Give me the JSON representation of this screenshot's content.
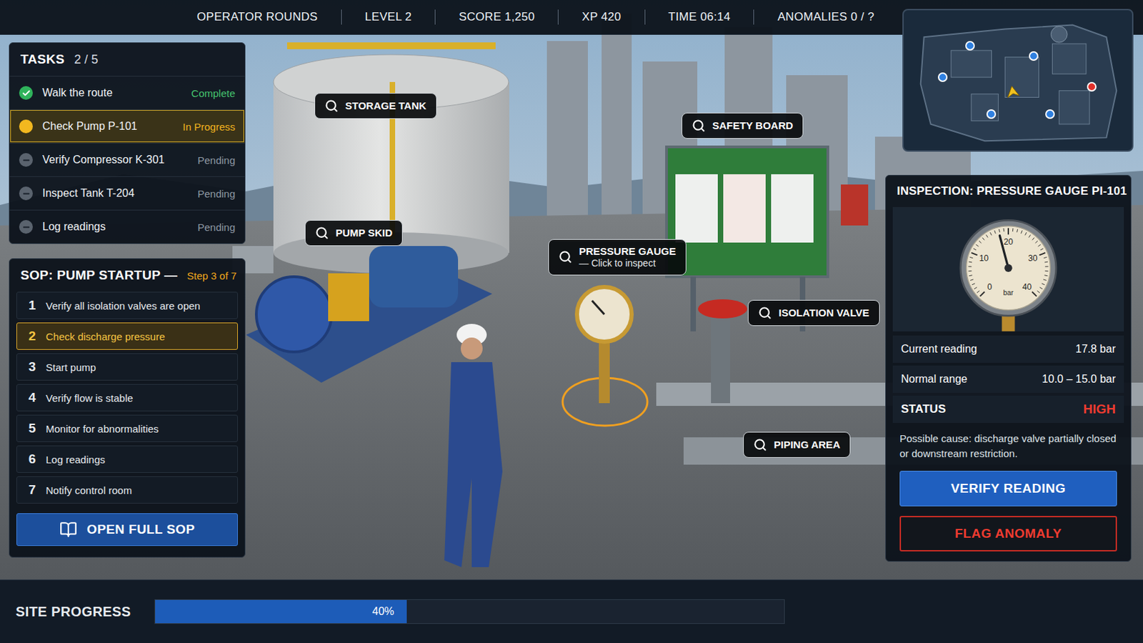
{
  "hud": {
    "items": [
      "OPERATOR ROUNDS",
      "LEVEL 2",
      "SCORE 1,250",
      "XP 420",
      "TIME 06:14",
      "ANOMALIES 0 / ?"
    ]
  },
  "minimap": {
    "markers": [
      {
        "color": "#2f80e0"
      },
      {
        "color": "#2f80e0"
      },
      {
        "color": "#2f80e0"
      },
      {
        "color": "#2f80e0"
      },
      {
        "color": "#2f80e0"
      },
      {
        "color": "#e0302a"
      }
    ]
  },
  "tasks": {
    "title": "TASKS",
    "count": "2 / 5",
    "items": [
      {
        "label": "Walk the route",
        "status": "Complete",
        "kind": "complete",
        "selected": false
      },
      {
        "label": "Check Pump P-101",
        "status": "In Progress",
        "kind": "active",
        "selected": true
      },
      {
        "label": "Verify Compressor K-301",
        "status": "Pending",
        "kind": "pending",
        "selected": false
      },
      {
        "label": "Inspect Tank T-204",
        "status": "Pending",
        "kind": "pending",
        "selected": false
      },
      {
        "label": "Log readings",
        "status": "Pending",
        "kind": "pending",
        "selected": false
      }
    ]
  },
  "sop": {
    "title": "SOP: PUMP STARTUP —",
    "step": "Step 3 of 7",
    "steps": [
      {
        "number": "1",
        "label": "Verify all isolation valves are open",
        "selected": false
      },
      {
        "number": "2",
        "label": "Check discharge pressure",
        "selected": true
      },
      {
        "number": "3",
        "label": "Start pump",
        "selected": false
      },
      {
        "number": "4",
        "label": "Verify flow is stable",
        "selected": false
      },
      {
        "number": "5",
        "label": "Monitor for abnormalities",
        "selected": false
      },
      {
        "number": "6",
        "label": "Log readings",
        "selected": false
      },
      {
        "number": "7",
        "label": "Notify control room",
        "selected": false
      }
    ],
    "button": "OPEN FULL SOP"
  },
  "scene_labels": [
    {
      "label": "STORAGE TANK",
      "hint": ""
    },
    {
      "label": "PUMP SKID",
      "hint": ""
    },
    {
      "label": "SAFETY BOARD",
      "hint": ""
    },
    {
      "label": "PRESSURE GAUGE",
      "hint": "— Click to inspect"
    },
    {
      "label": "ISOLATION VALVE",
      "hint": ""
    },
    {
      "label": "PIPING AREA",
      "hint": ""
    }
  ],
  "inspection": {
    "title": "INSPECTION: PRESSURE GAUGE PI-101",
    "gauge": {
      "ticks": [
        "0",
        "10",
        "20",
        "30",
        "40"
      ],
      "unit": "bar",
      "level": 0.445
    },
    "rows": [
      {
        "label": "Current reading",
        "value": "17.8 bar",
        "kind": "normal"
      },
      {
        "label": "Normal range",
        "value": "10.0 – 15.0 bar",
        "kind": "normal"
      },
      {
        "label": "STATUS",
        "value": "HIGH",
        "kind": "status"
      }
    ],
    "note": "Possible cause: discharge valve partially closed or downstream restriction.",
    "buttons": [
      {
        "label": "VERIFY READING",
        "kind": "primary"
      },
      {
        "label": "FLAG ANOMALY",
        "kind": "danger"
      }
    ]
  },
  "progress": {
    "label": "SITE PROGRESS",
    "level": 0.4,
    "reading": "40%"
  }
}
